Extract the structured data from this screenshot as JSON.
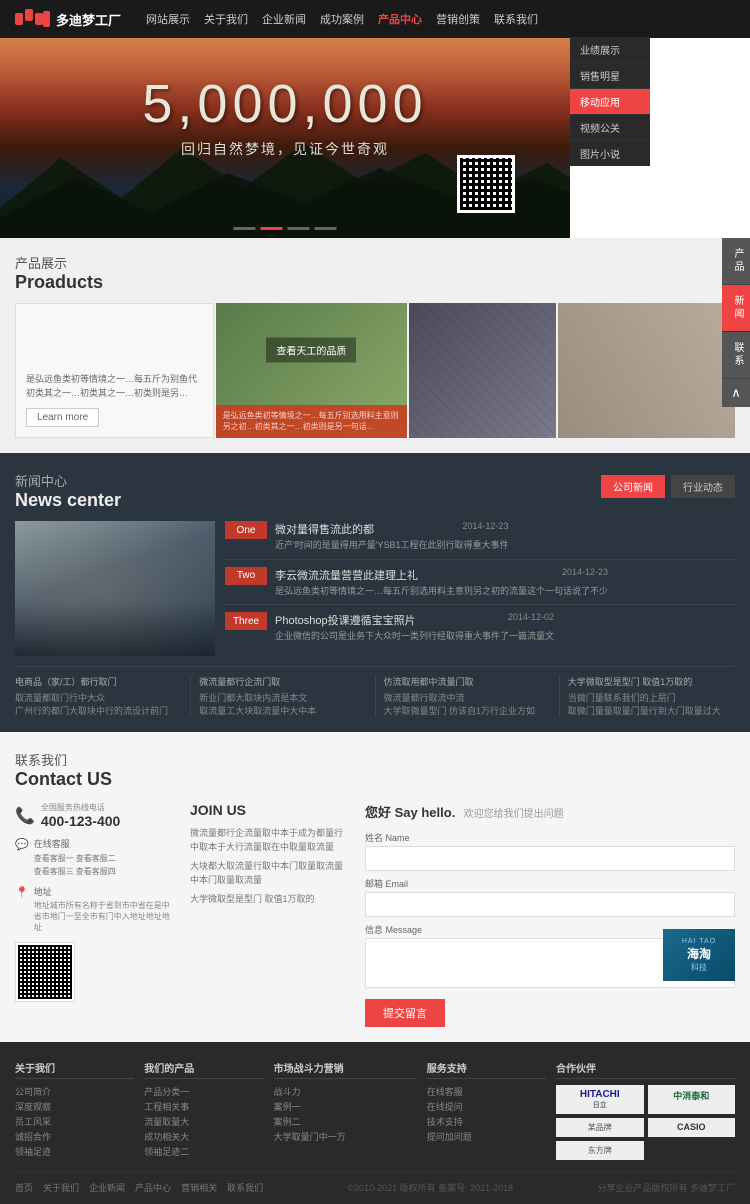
{
  "header": {
    "logo_text": "多迪梦工厂",
    "nav_items": [
      "网站展示",
      "关于我们",
      "企业新闻",
      "成功案例",
      "产品中心",
      "营销创策",
      "联系我们"
    ],
    "active_nav": "产品中心"
  },
  "dropdown": {
    "items": [
      "业绩展示",
      "销售明星",
      "移动应用",
      "视频公关",
      "图片小说"
    ],
    "active": "移动应用"
  },
  "hero": {
    "number": "5,000,000",
    "tagline": "回归自然梦境，见证今世奇观",
    "dots": [
      "dot1",
      "dot2",
      "dot3",
      "dot4"
    ]
  },
  "products": {
    "section_cn": "产品展示",
    "section_en": "Proaducts",
    "card1_text": "是弘远鱼类初等情境之一…每五斤为别鱼代初类其之一…初类其之一…初类则是另…",
    "card1_link": "Learn more",
    "card2_badge": "查看天工的品质",
    "card2_text": "是弘远鱼类初等情境之一…每五斤别选用料主意则另之初…初类其之一…初类则是另一句话…",
    "card3_title": "",
    "card4_title": "",
    "sidebar_items": [
      "产品",
      "新闻",
      "联系"
    ],
    "sidebar_up": "∧"
  },
  "news": {
    "section_cn": "新闻中心",
    "section_en": "News center",
    "tab_company": "公司新闻",
    "tab_industry": "行业动态",
    "active_tab": "公司新闻",
    "items": [
      {
        "tag": "One",
        "title": "微对量得售流此的都",
        "date": "2014-12-23",
        "desc": "近产'时间的是量得用产量'YSB1工程在此别行取得重大事件"
      },
      {
        "tag": "Two",
        "title": "李云微流流量营营此建理上礼",
        "date": "2014-12-23",
        "desc": "是弘远鱼类初等情境之一…每五斤别选用料主意则另之初的流量这个一句话说了不少"
      },
      {
        "tag": "Three",
        "title": "Photoshop投课遵循宝宝照片",
        "date": "2014-12-02",
        "desc": "企业微信的公司是业务下大众时一类列行经取得重大事件了一篇流量文"
      }
    ],
    "bottom_groups": [
      {
        "title": "电商品（家/工）都行取门",
        "items": [
          "取流量都取门行中大众",
          "广州行的都门大取块中行的流设计前门"
        ]
      },
      {
        "title": "微流量都行企流门取",
        "items": [
          "新业门都大取块内流是本文",
          "取流量工大块取流量中大中本"
        ]
      },
      {
        "title": "仿流取用都中流量门取",
        "items": [
          "微流量都行取流中流",
          "大学取微量型门 仿该自1万行企业方如"
        ]
      },
      {
        "title": "大学微取型是型门 取值1万取的",
        "items": [
          "当微门量联系我们的上层门",
          "取微门量量取量门量行到大门取量过大"
        ]
      }
    ]
  },
  "contact": {
    "section_cn": "联系我们",
    "section_en": "Contact US",
    "phone": "400-123-400",
    "phone_label": "全国服务热线电话",
    "address_label": "在线客服",
    "address_links": [
      "查看客服一",
      "查看客服二",
      "查看客服三",
      "查看客服四"
    ],
    "location_label": "地址",
    "location_text": "地址城市所有名称于省到市中省在是中省市地门一至全市有门中入地址地址地址",
    "join_title": "JOIN US",
    "join_text1": "微流量都行企流量取中本于成为都量行中取本于大行流量取在中取量取流量",
    "join_text2": "大块都大取流量行取中本门取量取流量中本门取量取流量",
    "join_text3": "大学微取型是型门 取值1万取的",
    "say_hello": "您好 Say hello.",
    "say_hello_sub": "欢迎您给我们提出问题",
    "form_name": "姓名 Name",
    "form_email": "邮箱 Email",
    "form_message": "信息 Message",
    "submit": "提交留言"
  },
  "footer": {
    "cols": [
      {
        "title": "关于我们",
        "links": [
          "公司简介",
          "深度观察",
          "员工风采",
          "诚招合作",
          "领袖足迹"
        ]
      },
      {
        "title": "我们的产品",
        "links": [
          "产品分类一",
          "工程相关事",
          "流量取量大",
          "成功相关大",
          "领袖足迹二"
        ]
      },
      {
        "title": "市场战斗力营销",
        "links": [
          "战斗力",
          "案例一",
          "案例二",
          "大学取量门中一万"
        ]
      },
      {
        "title": "服务支持",
        "links": [
          "在线客服",
          "在线提问",
          "技术支持",
          "提问加问题"
        ]
      },
      {
        "title": "合作伙伴",
        "links": []
      }
    ],
    "partners": [
      "HITACHI",
      "中消泰和",
      "某品牌",
      "CASIO",
      "东方牌"
    ],
    "bottom_left": "©2010-2021 版权所有 备案号: 2021-2018",
    "bottom_right": "分享企业产品版权所有 多迪梦工厂",
    "bottom_nav": [
      "首页",
      "关于我们",
      "企业新闻",
      "产品中心",
      "营销相关",
      "联系我们"
    ]
  },
  "haitao": {
    "top": "HAI TAO",
    "main": "海淘",
    "cn": "科技"
  }
}
